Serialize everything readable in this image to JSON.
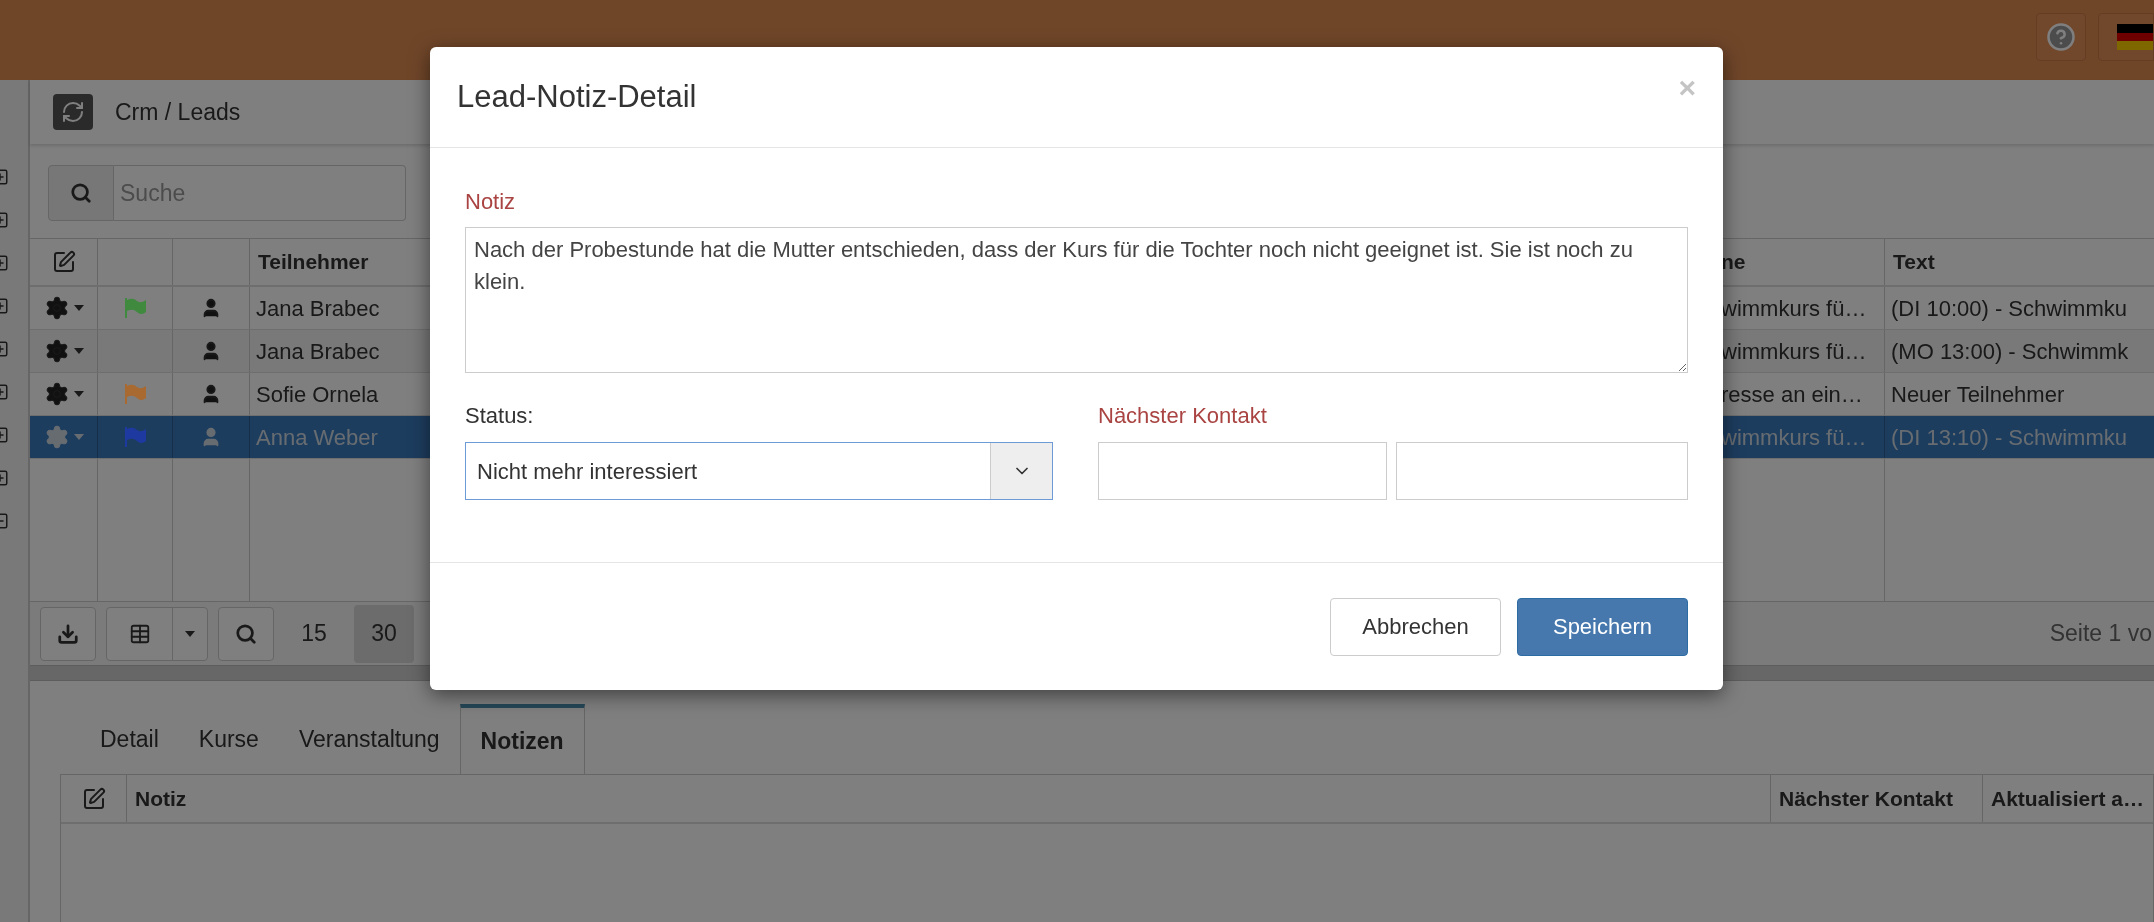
{
  "breadcrumb": "Crm / Leads",
  "search": {
    "placeholder": "Suche"
  },
  "leads_table": {
    "columns": [
      "Teilnehmer",
      "ne",
      "Text"
    ],
    "rows": [
      {
        "flag": true,
        "color": "#3f8a3f",
        "name": "Jana Brabec",
        "column_5": "wimmkurs fü…",
        "text": "(DI 10:00) - Schwimmku",
        "selected": false
      },
      {
        "flag": false,
        "name": "Jana Brabec",
        "column_5": "wimmkurs fü…",
        "text": "(MO 13:00) - Schwimmk",
        "selected": false
      },
      {
        "flag": true,
        "color": "#a86a30",
        "name": "Sofie Ornela",
        "column_5": "resse an ein…",
        "text": "Neuer Teilnehmer",
        "selected": false
      },
      {
        "flag": true,
        "color": "#1e3aa0",
        "name": "Anna Weber",
        "column_5": "wimmkurs fü…",
        "text": "(DI 13:10) - Schwimmku",
        "selected": true
      }
    ]
  },
  "pager": {
    "sizes": [
      {
        "label": "15",
        "selected": false
      },
      {
        "label": "30",
        "selected": true
      }
    ],
    "page_info": "Seite 1 vo"
  },
  "bottom_tabs": [
    {
      "label": "Detail",
      "selected": false
    },
    {
      "label": "Kurse",
      "selected": false
    },
    {
      "label": "Veranstaltung",
      "selected": false
    },
    {
      "label": "Notizen",
      "selected": true
    }
  ],
  "notes_table": {
    "columns": [
      "Notiz",
      "Nächster Kontakt",
      "Aktualisiert a…"
    ]
  },
  "modal": {
    "title": "Lead-Notiz-Detail",
    "close": "×",
    "note": {
      "label": "Notiz",
      "required": true,
      "value": "Nach der Probestunde hat die Mutter entschieden, dass der Kurs für die Tochter noch nicht geeignet ist. Sie ist noch zu klein."
    },
    "status": {
      "label": "Status:",
      "required": false,
      "value": "Nicht mehr interessiert"
    },
    "next_contact": {
      "label": "Nächster Kontakt",
      "required": true
    },
    "buttons": {
      "cancel": "Abbrechen",
      "save": "Speichern"
    }
  }
}
